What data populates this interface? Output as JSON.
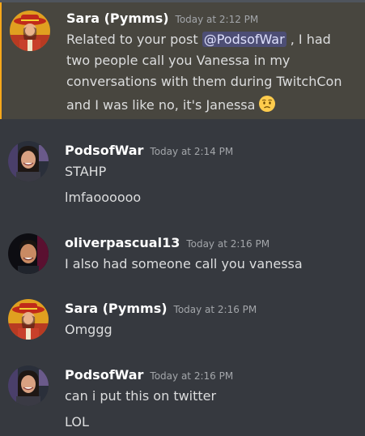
{
  "messages": [
    {
      "username": "Sara (Pymms)",
      "time": "Today at 2:12 PM",
      "lines": {
        "l1_pre": "Related to your post ",
        "l1_mention": "@PodsofWar",
        "l1_post": " , I had",
        "l2": "two people call you Vanessa in my",
        "l3": "conversations with them during TwitchCon",
        "l4": "and I was like no, it's Janessa"
      },
      "emoji": "confused-face-emoji"
    },
    {
      "username": "PodsofWar",
      "time": "Today at 2:14 PM",
      "lines": [
        "STAHP",
        "lmfaoooooo"
      ]
    },
    {
      "username": "oliverpascual13",
      "time": "Today at 2:16 PM",
      "lines": [
        "I also had someone call you vanessa"
      ]
    },
    {
      "username": "Sara (Pymms)",
      "time": "Today at 2:16 PM",
      "lines": [
        "Omggg"
      ]
    },
    {
      "username": "PodsofWar",
      "time": "Today at 2:16 PM",
      "lines": [
        "can i put this on twitter",
        "LOL"
      ]
    }
  ],
  "colors": {
    "background": "#36393f",
    "highlight": "#48463f",
    "highlight_bar": "#faa81a",
    "mention_bg": "#5865f2",
    "username": "#ffffff",
    "timestamp": "#a3a6aa",
    "text": "#dcddde"
  }
}
